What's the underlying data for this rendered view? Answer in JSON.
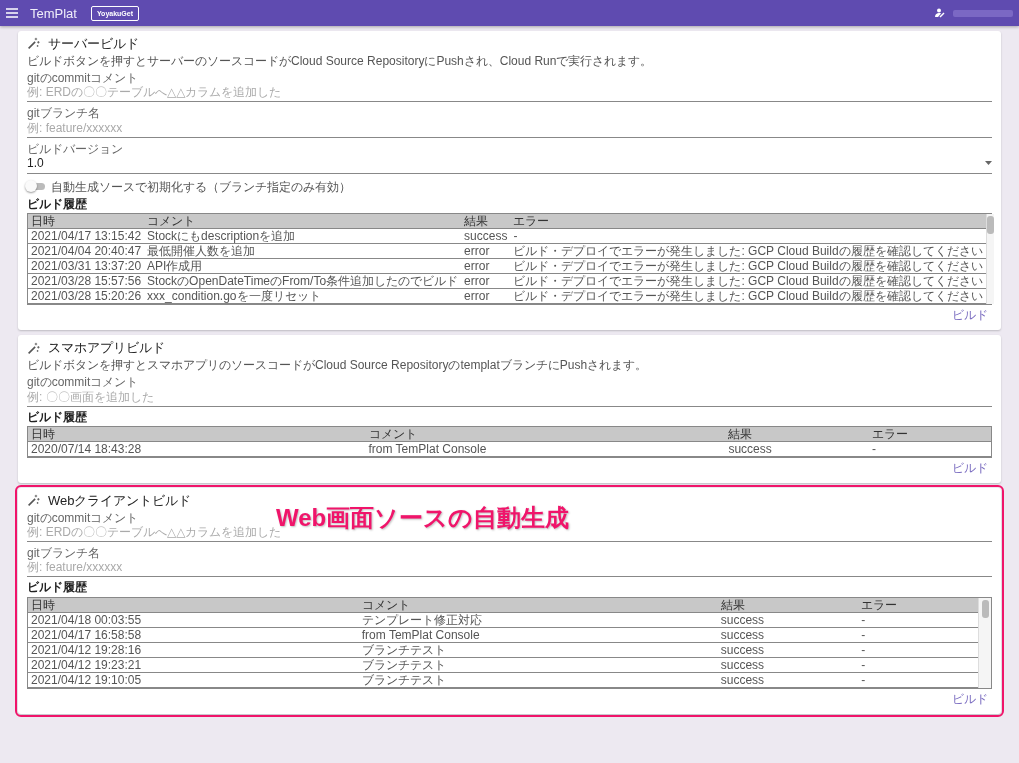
{
  "app_bar": {
    "title": "TemPlat",
    "button": "YoyakuGet"
  },
  "cards": [
    {
      "title": "サーバービルド",
      "description": "ビルドボタンを押すとサーバーのソースコードがCloud Source RepositoryにPushされ、Cloud Runで実行されます。",
      "highlighted": false,
      "fields": [
        {
          "kind": "text",
          "label": "gitのcommitコメント",
          "placeholder": "例: ERDの〇〇テーブルへ△△カラムを追加した"
        },
        {
          "kind": "text",
          "label": "gitブランチ名",
          "placeholder": "例: feature/xxxxxx"
        },
        {
          "kind": "select",
          "label": "ビルドバージョン",
          "value": "1.0"
        }
      ],
      "toggle": {
        "label": "自動生成ソースで初期化する（ブランチ指定のみ有効）",
        "on": false
      },
      "history_label": "ビルド履歴",
      "table": {
        "scrollable": true,
        "columns": [
          "日時",
          "コメント",
          "結果",
          "エラー"
        ],
        "rows": [
          [
            "2021/04/17 13:15:42",
            "Stockにもdescriptionを追加",
            "success",
            "-"
          ],
          [
            "2021/04/04 20:40:47",
            "最低開催人数を追加",
            "error",
            "ビルド・デプロイでエラーが発生しました: GCP Cloud Buildの履歴を確認してください"
          ],
          [
            "2021/03/31 13:37:20",
            "API作成用",
            "error",
            "ビルド・デプロイでエラーが発生しました: GCP Cloud Buildの履歴を確認してください"
          ],
          [
            "2021/03/28 15:57:56",
            "StockのOpenDateTimeのFrom/To条件追加したのでビルド",
            "error",
            "ビルド・デプロイでエラーが発生しました: GCP Cloud Buildの履歴を確認してください"
          ],
          [
            "2021/03/28 15:20:26",
            "xxx_condition.goを一度リセット",
            "error",
            "ビルド・デプロイでエラーが発生しました: GCP Cloud Buildの履歴を確認してください"
          ]
        ]
      },
      "action": "ビルド"
    },
    {
      "title": "スマホアプリビルド",
      "description": "ビルドボタンを押すとスマホアプリのソースコードがCloud Source RepositoryのtemplatブランチにPushされます。",
      "highlighted": false,
      "fields": [
        {
          "kind": "text",
          "label": "gitのcommitコメント",
          "placeholder": "例: 〇〇画面を追加した"
        }
      ],
      "history_label": "ビルド履歴",
      "table": {
        "scrollable": false,
        "columns": [
          "日時",
          "コメント",
          "結果",
          "エラー"
        ],
        "rows": [
          [
            "2020/07/14 18:43:28",
            "from TemPlat Console",
            "success",
            "-"
          ]
        ]
      },
      "action": "ビルド"
    },
    {
      "title": "Webクライアントビルド",
      "highlighted": true,
      "annotation": "Web画面ソースの自動生成",
      "fields": [
        {
          "kind": "text",
          "label": "gitのcommitコメント",
          "placeholder": "例: ERDの〇〇テーブルへ△△カラムを追加した"
        },
        {
          "kind": "text",
          "label": "gitブランチ名",
          "placeholder": "例: feature/xxxxxx"
        }
      ],
      "history_label": "ビルド履歴",
      "table": {
        "scrollable": true,
        "columns": [
          "日時",
          "コメント",
          "結果",
          "エラー"
        ],
        "rows": [
          [
            "2021/04/18 00:03:55",
            "テンプレート修正対応",
            "success",
            "-"
          ],
          [
            "2021/04/17 16:58:58",
            "from TemPlat Console",
            "success",
            "-"
          ],
          [
            "2021/04/12 19:28:16",
            "ブランチテスト",
            "success",
            "-"
          ],
          [
            "2021/04/12 19:23:21",
            "ブランチテスト",
            "success",
            "-"
          ],
          [
            "2021/04/12 19:10:05",
            "ブランチテスト",
            "success",
            "-"
          ]
        ]
      },
      "action": "ビルド"
    }
  ]
}
